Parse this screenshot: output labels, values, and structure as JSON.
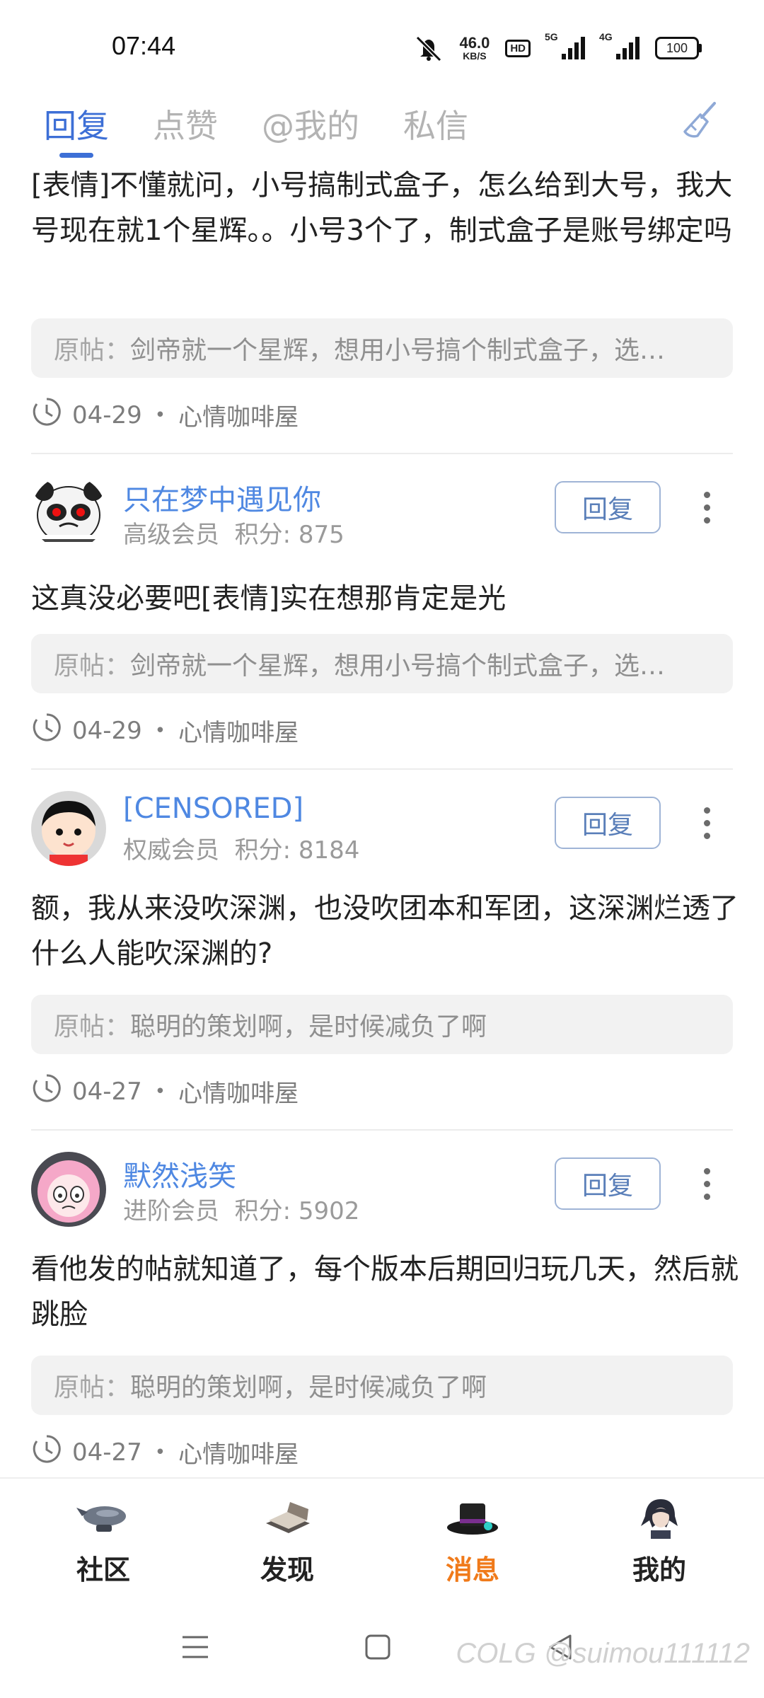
{
  "status_bar": {
    "time": "07:44",
    "net_speed_value": "46.0",
    "net_speed_unit": "KB/S",
    "hd_label": "HD",
    "sim1_tag": "5G",
    "sim2_tag": "4G",
    "battery": "100"
  },
  "tabs": [
    {
      "label": "回复",
      "active": true
    },
    {
      "label": "点赞",
      "active": false
    },
    {
      "label": "@我的",
      "active": false
    },
    {
      "label": "私信",
      "active": false
    }
  ],
  "icons": {
    "clear": "broom-icon",
    "more": "more-vertical-icon",
    "time": "clock-icon"
  },
  "colors": {
    "accent": "#3d6fd6",
    "username": "#4f88e2",
    "active_nav": "#f07a1a"
  },
  "items": [
    {
      "comment": "[表情]不懂就问，小号搞制式盒子，怎么给到大号，我大号现在就1个星辉。。小号3个了，制式盒子是账号绑定吗",
      "quote_prefix": "原帖：",
      "quote_text": "剑帝就一个星辉，想用小号搞个制式盒子，选…",
      "date": "04-29",
      "forum": "心情咖啡屋"
    },
    {
      "user": "只在梦中遇见你",
      "level": "高级会员",
      "score_label": "积分:",
      "score": "875",
      "reply_label": "回复",
      "comment": "这真没必要吧[表情]实在想那肯定是光",
      "quote_prefix": "原帖：",
      "quote_text": "剑帝就一个星辉，想用小号搞个制式盒子，选…",
      "date": "04-29",
      "forum": "心情咖啡屋"
    },
    {
      "user": "[CENSORED]",
      "level": "权威会员",
      "score_label": "积分:",
      "score": "8184",
      "reply_label": "回复",
      "comment": "额，我从来没吹深渊，也没吹团本和军团，这深渊烂透了什么人能吹深渊的?",
      "quote_prefix": "原帖：",
      "quote_text": "聪明的策划啊，是时候减负了啊",
      "date": "04-27",
      "forum": "心情咖啡屋"
    },
    {
      "user": "默然浅笑",
      "level": "进阶会员",
      "score_label": "积分:",
      "score": "5902",
      "reply_label": "回复",
      "comment": "看他发的帖就知道了，每个版本后期回归玩几天，然后就跳脸",
      "quote_prefix": "原帖：",
      "quote_text": "聪明的策划啊，是时候减负了啊",
      "date": "04-27",
      "forum": "心情咖啡屋"
    }
  ],
  "separator": "•",
  "bottom_nav": [
    {
      "label": "社区",
      "icon": "airship-icon",
      "active": false
    },
    {
      "label": "发现",
      "icon": "book-icon",
      "active": false
    },
    {
      "label": "消息",
      "icon": "top-hat-icon",
      "active": true
    },
    {
      "label": "我的",
      "icon": "character-avatar-icon",
      "active": false
    }
  ],
  "system_nav": {
    "menu": "menu-icon",
    "home": "home-icon",
    "back": "back-icon"
  },
  "watermark": "COLG @suimou111112"
}
